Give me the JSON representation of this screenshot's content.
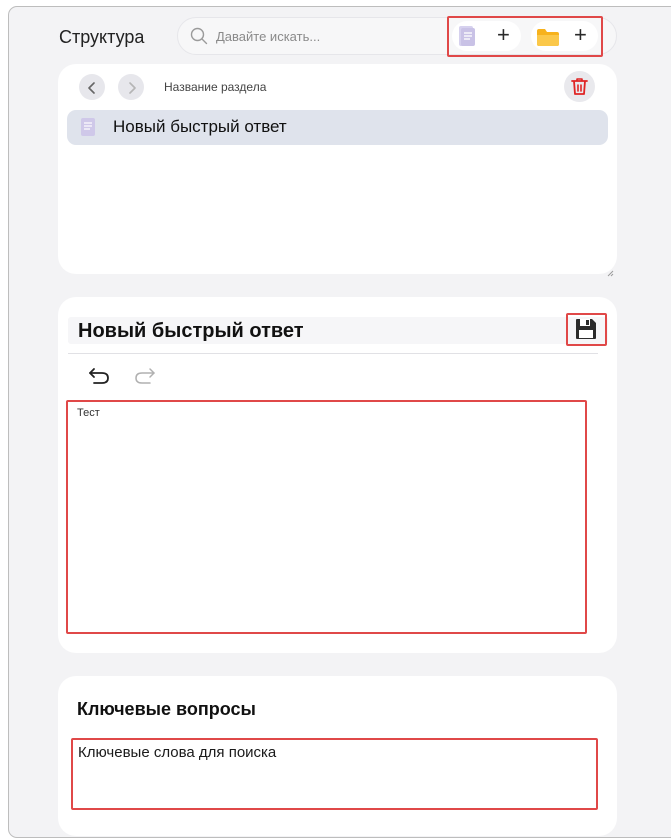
{
  "structure": {
    "title": "Структура",
    "search_placeholder": "Давайте искать...",
    "add_doc_label": "+",
    "add_folder_label": "+"
  },
  "nav": {
    "section_name": "Название раздела"
  },
  "tree": {
    "items": [
      {
        "label": "Новый быстрый ответ",
        "selected": true,
        "icon": "document-icon"
      }
    ]
  },
  "editor": {
    "title": "Новый быстрый ответ",
    "content": "Тест"
  },
  "keywords": {
    "title": "Ключевые вопросы",
    "placeholder": "Ключевые слова для поиска"
  },
  "colors": {
    "accent_red": "#e04848",
    "delete_red": "#e02424",
    "folder_orange": "#f7b21c",
    "doc_lavender": "#c9c2e6",
    "selected_row": "#dfe3ec"
  }
}
